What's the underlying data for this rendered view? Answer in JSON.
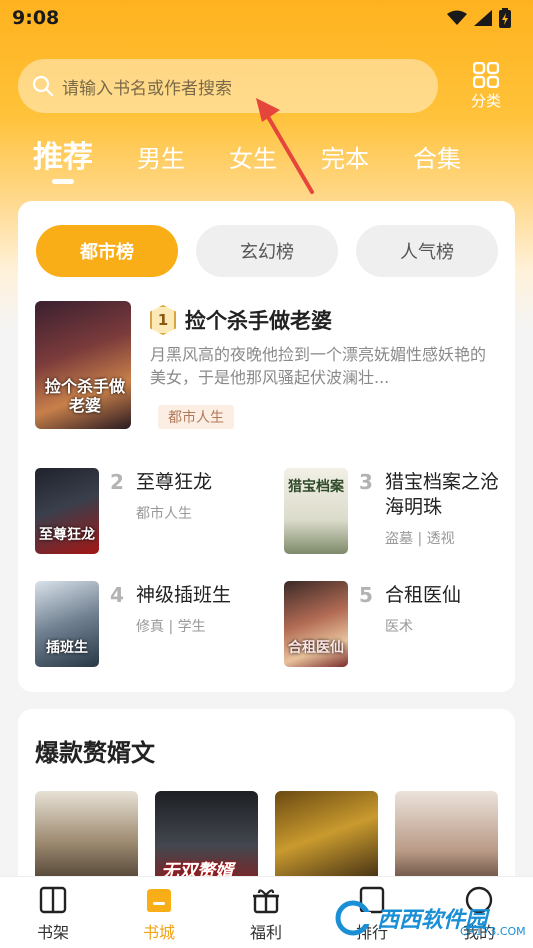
{
  "status_bar": {
    "time": "9:08"
  },
  "search": {
    "placeholder": "请输入书名或作者搜索"
  },
  "category": {
    "label": "分类"
  },
  "tabs": [
    {
      "label": "推荐",
      "active": true
    },
    {
      "label": "男生"
    },
    {
      "label": "女生"
    },
    {
      "label": "完本"
    },
    {
      "label": "合集"
    }
  ],
  "rank_tabs": [
    {
      "label": "都市榜",
      "active": true
    },
    {
      "label": "玄幻榜"
    },
    {
      "label": "人气榜"
    }
  ],
  "top_book": {
    "rank": "1",
    "title": "捡个杀手做老婆",
    "cover_text": "捡个杀手做老婆",
    "description": "月黑风高的夜晚他捡到一个漂亮妩媚性感妖艳的美女，于是他那风骚起伏波澜壮...",
    "tag": "都市人生"
  },
  "books": [
    {
      "rank": "2",
      "title": "至尊狂龙",
      "tags": "都市人生",
      "cover_text": "至尊狂龙"
    },
    {
      "rank": "3",
      "title": "猎宝档案之沧海明珠",
      "tags": "盗墓 | 透视",
      "cover_text": "猎宝档案"
    },
    {
      "rank": "4",
      "title": "神级插班生",
      "tags": "修真 | 学生",
      "cover_text": "插班生"
    },
    {
      "rank": "5",
      "title": "合租医仙",
      "tags": "医术",
      "cover_text": "合租医仙"
    }
  ],
  "section2": {
    "title": "爆款赘婿文",
    "cover2_text": "无双赘婿"
  },
  "bottom_nav": [
    {
      "label": "书架",
      "icon": "book-icon"
    },
    {
      "label": "书城",
      "icon": "store-icon",
      "active": true
    },
    {
      "label": "福利",
      "icon": "gift-icon"
    },
    {
      "label": "排行",
      "icon": "rank-icon"
    },
    {
      "label": "我的",
      "icon": "user-icon"
    }
  ],
  "watermark": {
    "text": "西西软件园",
    "sub": "CR173.COM"
  },
  "colors": {
    "accent": "#f9ad16",
    "header": "#ffb21e"
  }
}
